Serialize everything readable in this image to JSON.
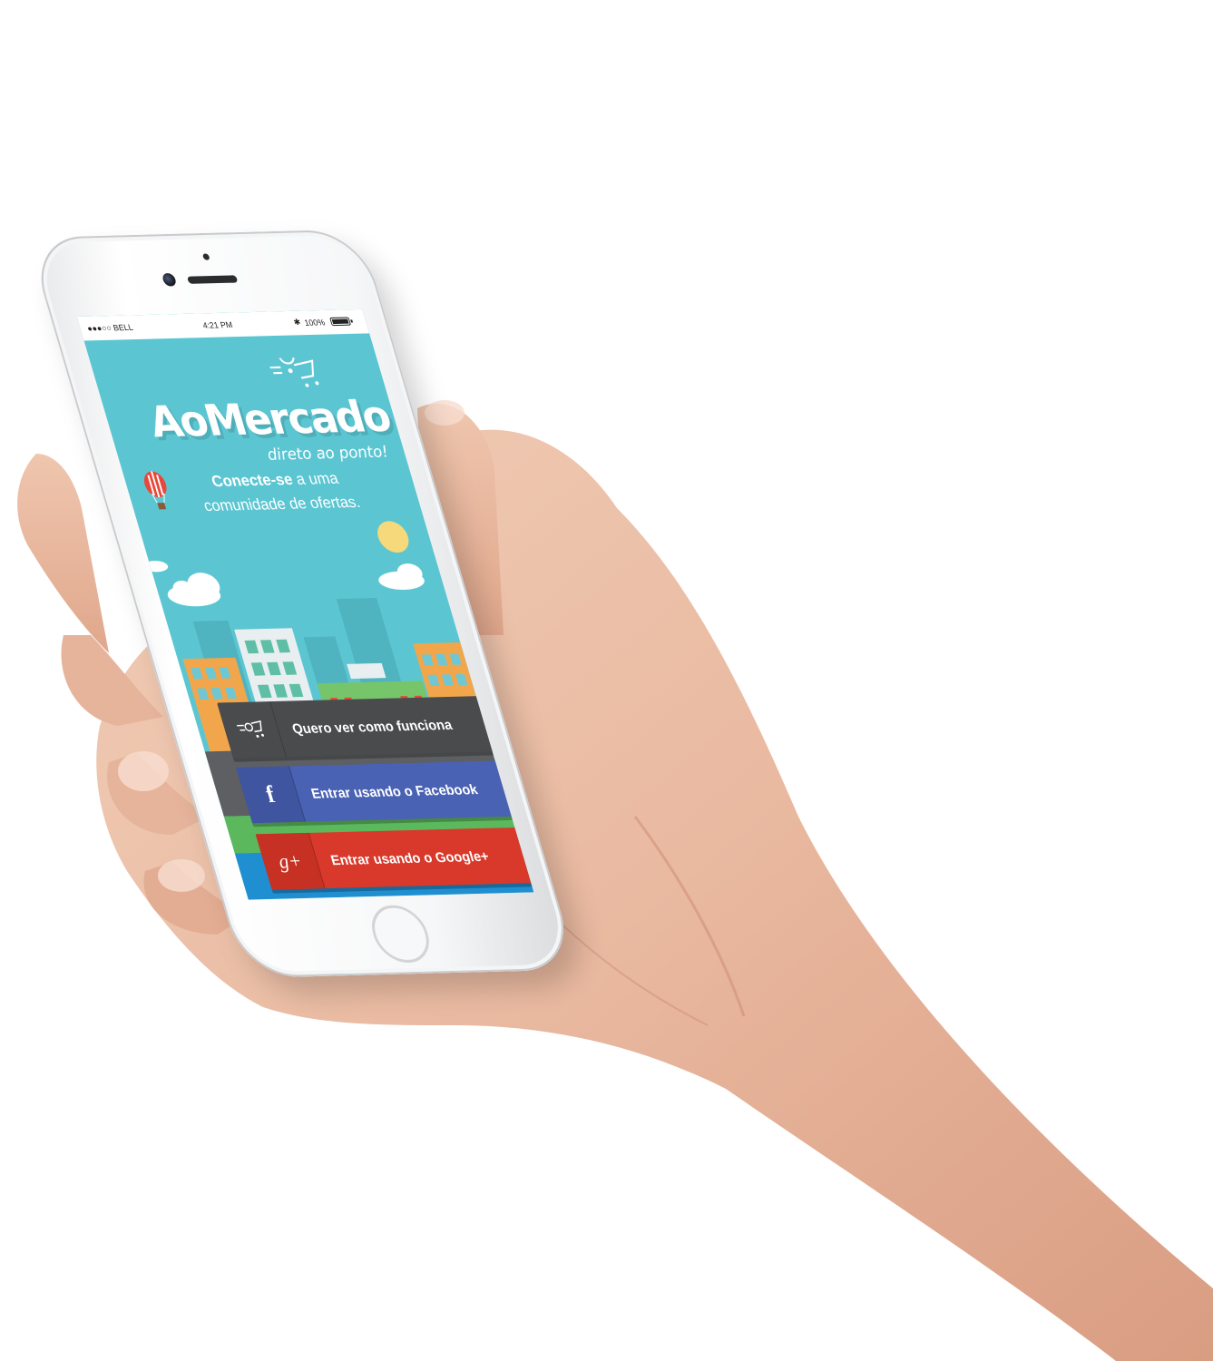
{
  "statusbar": {
    "carrier": "●●●○○ BELL",
    "time": "4:21 PM",
    "battery": "100%"
  },
  "app": {
    "logo": "AoMercado",
    "tagline": "direto ao ponto!",
    "headline_bold": "Conecte-se",
    "headline_rest": " a uma",
    "headline_line2": "comunidade de ofertas."
  },
  "buttons": {
    "how_it_works": "Quero ver como funciona",
    "facebook": "Entrar usando o Facebook",
    "google": "Entrar usando o Google+"
  },
  "icons": {
    "how_it_works": "cart-icon",
    "facebook": "facebook-icon",
    "google": "google-plus-icon"
  },
  "colors": {
    "screen_bg": "#5bc6d2",
    "button_dark": "#4a4b4d",
    "facebook": "#4a62b3",
    "google": "#d8392b"
  }
}
